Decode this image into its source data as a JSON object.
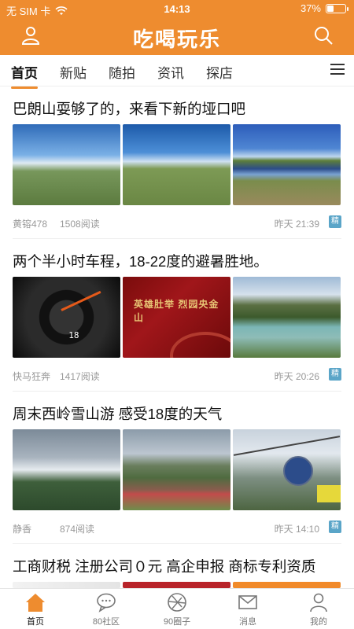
{
  "status_bar": {
    "carrier": "无 SIM 卡",
    "time": "14:13",
    "battery": "37%",
    "battery_fraction": 0.37
  },
  "header": {
    "title": "吃喝玩乐"
  },
  "tabs": [
    {
      "label": "首页",
      "active": true
    },
    {
      "label": "新贴",
      "active": false
    },
    {
      "label": "随拍",
      "active": false
    },
    {
      "label": "资讯",
      "active": false
    },
    {
      "label": "探店",
      "active": false
    }
  ],
  "posts": [
    {
      "title": "巴朗山耍够了的，来看下新的垭口吧",
      "author": "黄镕478",
      "reads": "1508阅读",
      "time": "昨天 21:39",
      "badge": "精"
    },
    {
      "title": "两个半小时车程，18-22度的避暑胜地。",
      "author": "快马狂奔",
      "reads": "1417阅读",
      "time": "昨天 20:26",
      "badge": "精"
    },
    {
      "title": "周末西岭雪山游 感受18度的天气",
      "author": "静香",
      "reads": "874阅读",
      "time": "昨天 14:10",
      "badge": "精"
    },
    {
      "title": "工商财税 注册公司０元 高企申报 商标专利资质"
    }
  ],
  "image_text": {
    "red_sign": "英雄肚举 烈园央金山",
    "dash_readout": "18"
  },
  "bottom_nav": [
    {
      "label": "首页",
      "icon": "home-icon",
      "active": true
    },
    {
      "label": "80社区",
      "icon": "chat-bubble-icon",
      "active": false
    },
    {
      "label": "90圈子",
      "icon": "aperture-icon",
      "active": false
    },
    {
      "label": "消息",
      "icon": "mail-icon",
      "active": false
    },
    {
      "label": "我的",
      "icon": "person-icon",
      "active": false
    }
  ],
  "colors": {
    "brand": "#ee8c2f",
    "badge": "#5aa5c8"
  }
}
